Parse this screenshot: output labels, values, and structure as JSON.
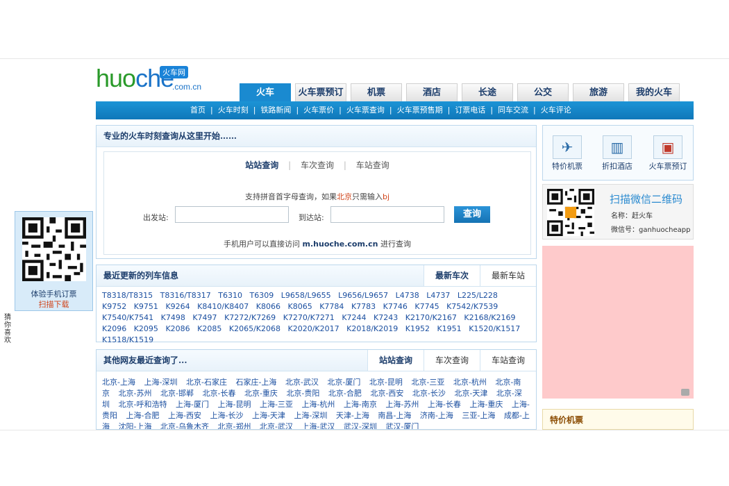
{
  "logo": {
    "text_a": "huo",
    "text_b": "che",
    "badge": "火车网",
    "domain": ".com.cn"
  },
  "tabs": [
    {
      "label": "火车",
      "active": true
    },
    {
      "label": "火车票预订"
    },
    {
      "label": "机票"
    },
    {
      "label": "酒店"
    },
    {
      "label": "长途"
    },
    {
      "label": "公交"
    },
    {
      "label": "旅游"
    },
    {
      "label": "我的火车"
    }
  ],
  "nav": [
    "首页",
    "火车时刻",
    "铁路新闻",
    "火车票价",
    "火车票查询",
    "火车票预售期",
    "订票电话",
    "同车交流",
    "火车评论"
  ],
  "search": {
    "title": "专业的火车时刻查询从这里开始……",
    "tabs": [
      "站站查询",
      "车次查询",
      "车站查询"
    ],
    "tip_a": "支持拼音首字母查询，如果",
    "tip_city": "北京",
    "tip_b": "只需输入",
    "tip_code": "bj",
    "from_label": "出发站:",
    "to_label": "到达站:",
    "button": "查询",
    "mobile_a": "手机用户可以直接访问",
    "mobile_url": "m.huoche.com.cn",
    "mobile_b": "进行查询"
  },
  "recent": {
    "title": "最近更新的列车信息",
    "tabs": [
      "最新车次",
      "最新车站"
    ],
    "trains": [
      "T8318/T8315",
      "T8316/T8317",
      "T6310",
      "T6309",
      "L9658/L9655",
      "L9656/L9657",
      "L4738",
      "L4737",
      "L225/L228",
      "K9752",
      "K9751",
      "K9264",
      "K8410/K8407",
      "K8066",
      "K8065",
      "K7784",
      "K7783",
      "K7746",
      "K7745",
      "K7542/K7539",
      "K7540/K7541",
      "K7498",
      "K7497",
      "K7272/K7269",
      "K7270/K7271",
      "K7244",
      "K7243",
      "K2170/K2167",
      "K2168/K2169",
      "K2096",
      "K2095",
      "K2086",
      "K2085",
      "K2065/K2068",
      "K2020/K2017",
      "K2018/K2019",
      "K1952",
      "K1951",
      "K1520/K1517",
      "K1518/K1519"
    ]
  },
  "others": {
    "title": "其他网友最近查询了...",
    "tabs": [
      "站站查询",
      "车次查询",
      "车站查询"
    ],
    "routes": [
      "北京-上海",
      "上海-深圳",
      "北京-石家庄",
      "石家庄-上海",
      "北京-武汉",
      "北京-厦门",
      "北京-昆明",
      "北京-三亚",
      "北京-杭州",
      "北京-南京",
      "北京-苏州",
      "北京-邯郸",
      "北京-长春",
      "北京-重庆",
      "北京-贵阳",
      "北京-合肥",
      "北京-西安",
      "北京-长沙",
      "北京-天津",
      "北京-深圳",
      "北京-呼和浩特",
      "上海-厦门",
      "上海-昆明",
      "上海-三亚",
      "上海-杭州",
      "上海-南京",
      "上海-苏州",
      "上海-长春",
      "上海-重庆",
      "上海-贵阳",
      "上海-合肥",
      "上海-西安",
      "上海-长沙",
      "上海-天津",
      "上海-深圳",
      "天津-上海",
      "南昌-上海",
      "济南-上海",
      "三亚-上海",
      "成都-上海",
      "沈阳-上海",
      "北京-乌鲁木齐",
      "北京-郑州",
      "北京-武汉",
      "上海-武汉",
      "武汉-深圳",
      "武汉-厦门"
    ]
  },
  "side": {
    "icons": [
      {
        "label": "特价机票",
        "icon": "airplane-icon"
      },
      {
        "label": "折扣酒店",
        "icon": "hotel-icon"
      },
      {
        "label": "火车票预订",
        "icon": "train-icon"
      }
    ],
    "wechat_title": "扫描微信二维码",
    "wechat_name": "名称：赶火车",
    "wechat_id": "微信号：ganhuocheapp",
    "special_title": "特价机票"
  },
  "float": {
    "line1": "体验手机订票",
    "line2": "扫描下载"
  },
  "vertical_text": "猜你喜欢"
}
